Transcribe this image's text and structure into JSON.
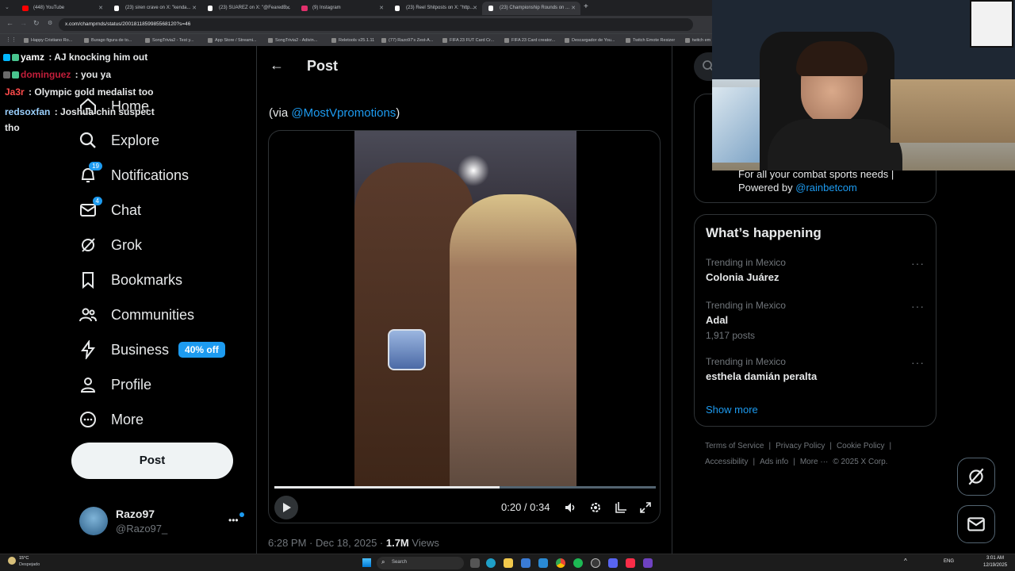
{
  "browser": {
    "tabs": [
      {
        "label": "(448) YouTube",
        "color": "#ff0000"
      },
      {
        "label": "(23) siren crave on X: \"kenda...",
        "color": "#ffffff"
      },
      {
        "label": "(23) SUAREZ on X: \"@FearedB...",
        "color": "#ffffff"
      },
      {
        "label": "(9) Instagram",
        "color": "#e1306c"
      },
      {
        "label": "(23) Reel Shitposts on X: \"http...",
        "color": "#ffffff"
      },
      {
        "label": "(23) Championship Rounds on ...",
        "color": "#ffffff"
      }
    ],
    "new_tab": "+",
    "url": "x.com/champrnds/status/2001811859985568120?s=46",
    "bookmarks": [
      "Happy Cristiano Ro...",
      "Burago figura de to...",
      "SongTrivia2 - Test y...",
      "App Store / Streami...",
      "SongTrivia2 - Adivin...",
      "Reletools v25.1.11",
      "(77) Razo97's Zest-A...",
      "FIFA 23 FUT Card Cr...",
      "FIFA 23 Card creator...",
      "Descargador de You...",
      "Twitch Emote Resizer",
      "twitch em"
    ]
  },
  "chat": [
    {
      "user": "yamz",
      "msg": "AJ knocking him out",
      "color": "#ffffff",
      "badge": "#00b7ff"
    },
    {
      "user": "dominguez",
      "msg": "you ya",
      "color": "#c21e3a",
      "badge": "#6a6a6a"
    },
    {
      "user": "Ja3r",
      "msg": "Olympic gold medalist too",
      "color": "#ff4b4b",
      "badge": ""
    },
    {
      "user": "redsoxfan",
      "msg": "Joshua chin suspect tho",
      "color": "#9bd1ff",
      "badge": ""
    }
  ],
  "chat_sep": " : ",
  "sidebar": {
    "items": [
      {
        "label": "Home"
      },
      {
        "label": "Explore"
      },
      {
        "label": "Notifications",
        "badge": "19"
      },
      {
        "label": "Chat",
        "badge": "4"
      },
      {
        "label": "Grok"
      },
      {
        "label": "Bookmarks"
      },
      {
        "label": "Communities"
      },
      {
        "label": "Business",
        "tag": "40% off"
      },
      {
        "label": "Profile"
      },
      {
        "label": "More"
      }
    ],
    "post_button": "Post",
    "account": {
      "name": "Razo97",
      "handle": "@Razo97_",
      "more": "•••"
    }
  },
  "main": {
    "back": "←",
    "title": "Post",
    "via_prefix": "(via ",
    "via_link": "@MostVpromotions",
    "via_suffix": ")",
    "video": {
      "time": "0:20 / 0:34",
      "progress": 0.59
    },
    "timestamp": "6:28 PM · Dec 18, 2025 · ",
    "views_count": "1.7M",
    "views_label": "Views"
  },
  "right": {
    "search_icon": "search-icon",
    "promo_line1": "For all your combat sports needs |",
    "promo_line2_prefix": "Powered by ",
    "promo_link": "@rainbetcom",
    "happening_title": "What’s happening",
    "trends": [
      {
        "context": "Trending in Mexico",
        "name": "Colonia Juárez",
        "posts": ""
      },
      {
        "context": "Trending in Mexico",
        "name": "Adal",
        "posts": "1,917 posts"
      },
      {
        "context": "Trending in Mexico",
        "name": "esthela damián peralta",
        "posts": ""
      }
    ],
    "show_more": "Show more",
    "footer": [
      "Terms of Service",
      "Privacy Policy",
      "Cookie Policy",
      "Accessibility",
      "Ads info",
      "More ···",
      "© 2025 X Corp."
    ]
  },
  "taskbar": {
    "weather_temp": "15°C",
    "weather_desc": "Despejado",
    "search": "Search",
    "lang": "ENG",
    "time": "3:01 AM",
    "date": "12/19/2025"
  }
}
